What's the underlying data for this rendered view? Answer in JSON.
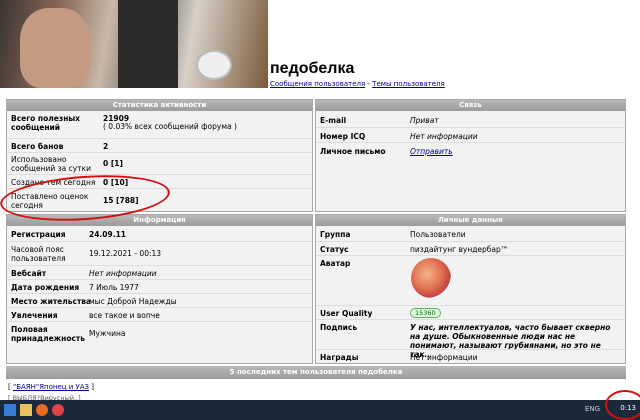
{
  "profile": {
    "username": "педобелка",
    "link_posts": "Сообщения пользователя",
    "link_sep": " - ",
    "link_topics": "Темы пользователя"
  },
  "activity": {
    "title": "Статистика активности",
    "rows": [
      {
        "label": "Всего полезных сообщений",
        "value": "21909",
        "sub": "( 0.03% всех сообщений форума )"
      },
      {
        "label": "Всего банов",
        "value": "2"
      },
      {
        "label": "Использовано сообщений за сутки",
        "value": "0 [1]"
      },
      {
        "label": "Создано тем сегодня",
        "value": "0 [10]"
      },
      {
        "label": "Поставлено оценок сегодня",
        "value": "15 [788]"
      }
    ]
  },
  "contact": {
    "title": "Связь",
    "rows": [
      {
        "label": "E-mail",
        "value": "Приват"
      },
      {
        "label": "Номер ICQ",
        "value": "Нет информации"
      },
      {
        "label": "Личное письмо",
        "value": "Отправить"
      }
    ]
  },
  "info": {
    "title": "Информация",
    "rows": [
      {
        "label": "Регистрация",
        "value": "24.09.11"
      },
      {
        "label": "Часовой пояс пользователя",
        "value": "19.12.2021 - 00:13"
      },
      {
        "label": "Вебсайт",
        "value": "Нет информации"
      },
      {
        "label": "Дата рождения",
        "value": "7 Июль 1977"
      },
      {
        "label": "Место жительства",
        "value": "мыс Доброй Надежды"
      },
      {
        "label": "Увлечения",
        "value": "все такое и вопче"
      },
      {
        "label": "Половая принадлежность",
        "value": "Мужчина"
      }
    ]
  },
  "personal": {
    "title": "Личные данные",
    "rows": [
      {
        "label": "Группа",
        "value": "Пользователи"
      },
      {
        "label": "Статус",
        "value": "пиздайтунг вундербар™"
      },
      {
        "label": "Аватар",
        "value": ""
      },
      {
        "label": "User Quality",
        "value": "15360"
      },
      {
        "label": "Подпись",
        "value": "У нас, интеллектуалов, часто бывает скверно на душе. Обыкновенные люди нас не понимают, называют грубиянами, но это не так.."
      },
      {
        "label": "Награды",
        "value": "Нет информации"
      }
    ]
  },
  "latest": {
    "title": "5 последних тем пользователя педобелка",
    "topic1": "\"БАЯН\"Японец и УАЗ",
    "topic2": "[ ВЫБЛЯ?Вирусный..]"
  },
  "taskbar": {
    "lang": "ENG",
    "clock": "0:13"
  },
  "colors": {
    "header_bg": "#a8a8a8",
    "link": "#000080",
    "annotation": "#d01010"
  }
}
